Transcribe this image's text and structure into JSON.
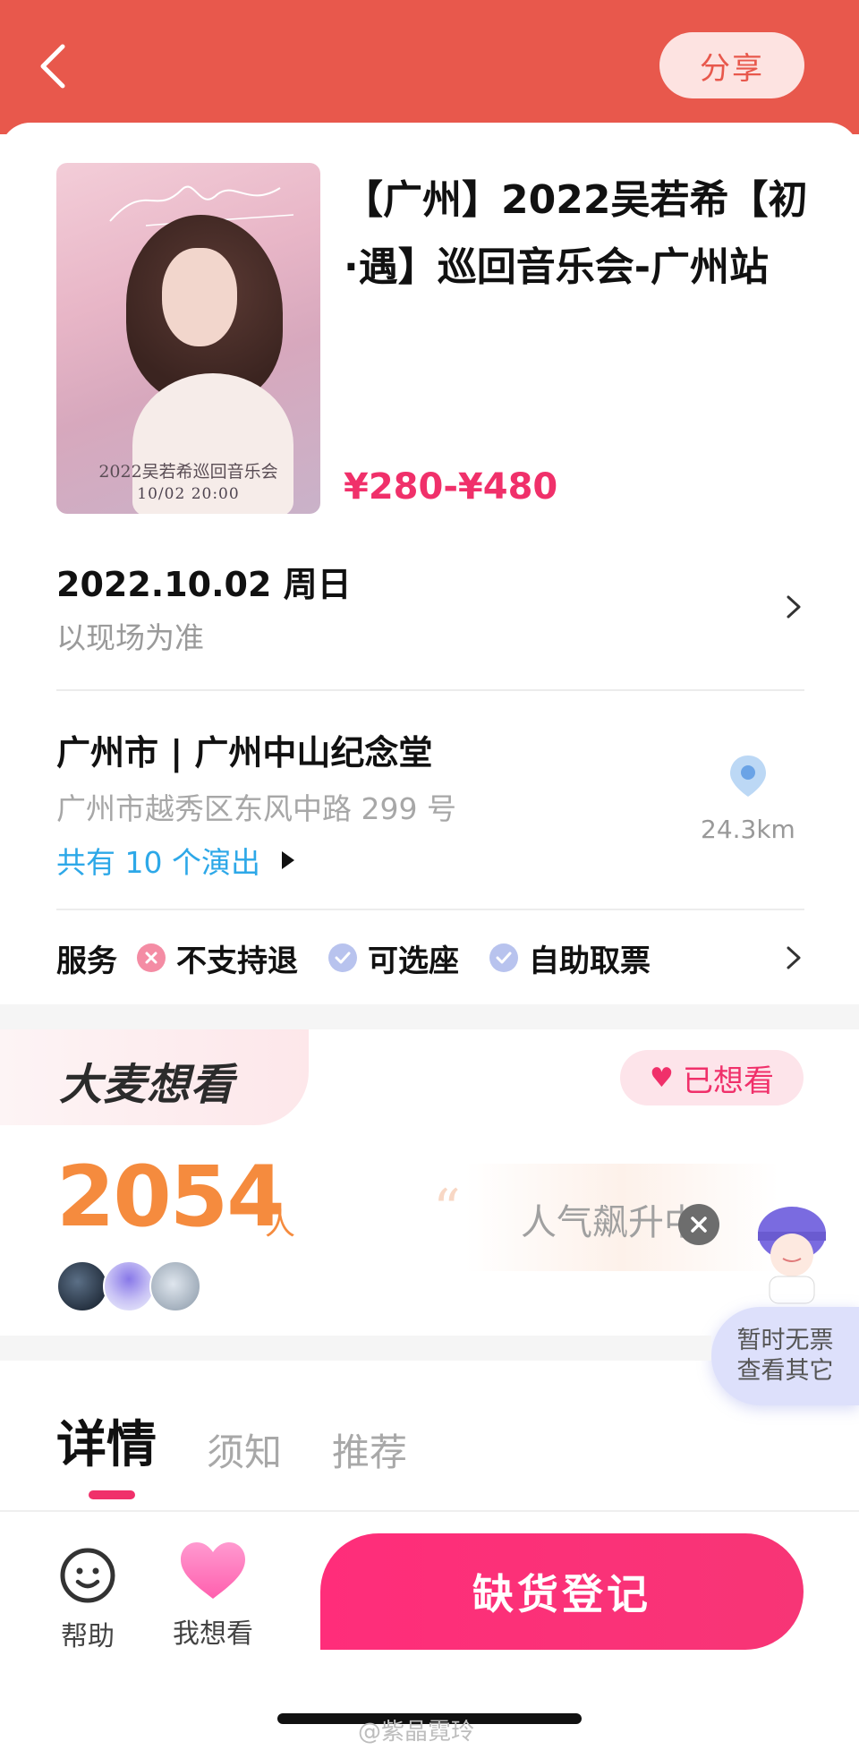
{
  "header": {
    "share_label": "分享"
  },
  "event": {
    "title": "【广州】2022吴若希【初·遇】巡回音乐会-广州站",
    "price": "¥280-¥480",
    "poster": {
      "subtitle": "2022吴若希巡回音乐会",
      "date": "10/02  20:00"
    }
  },
  "schedule": {
    "date": "2022.10.02 周日",
    "note": "以现场为准"
  },
  "venue": {
    "name": "广州市 | 广州中山纪念堂",
    "address": "广州市越秀区东风中路 299 号",
    "shows": "共有 10 个演出",
    "distance": "24.3km"
  },
  "services": {
    "title": "服务",
    "items": [
      {
        "label": "不支持退",
        "status": "no"
      },
      {
        "label": "可选座",
        "status": "yes"
      },
      {
        "label": "自助取票",
        "status": "yes"
      }
    ]
  },
  "want_section": {
    "logo": "大麦想看",
    "wanted_label": "已想看",
    "count": "2054",
    "count_unit": "人",
    "popularity": "人气飙升中"
  },
  "floating": {
    "line1": "暂时无票",
    "line2": "查看其它"
  },
  "tabs": [
    {
      "label": "详情",
      "active": true
    },
    {
      "label": "须知",
      "active": false
    },
    {
      "label": "推荐",
      "active": false
    }
  ],
  "bottom": {
    "help_label": "帮助",
    "want_label": "我想看",
    "cta_label": "缺货登记"
  },
  "watermark": "@紫晶霓玲",
  "colors": {
    "header_bg": "#e8584c",
    "accent_pink": "#f0306a",
    "count_orange": "#f58b3e",
    "link_blue": "#2da8e8"
  }
}
